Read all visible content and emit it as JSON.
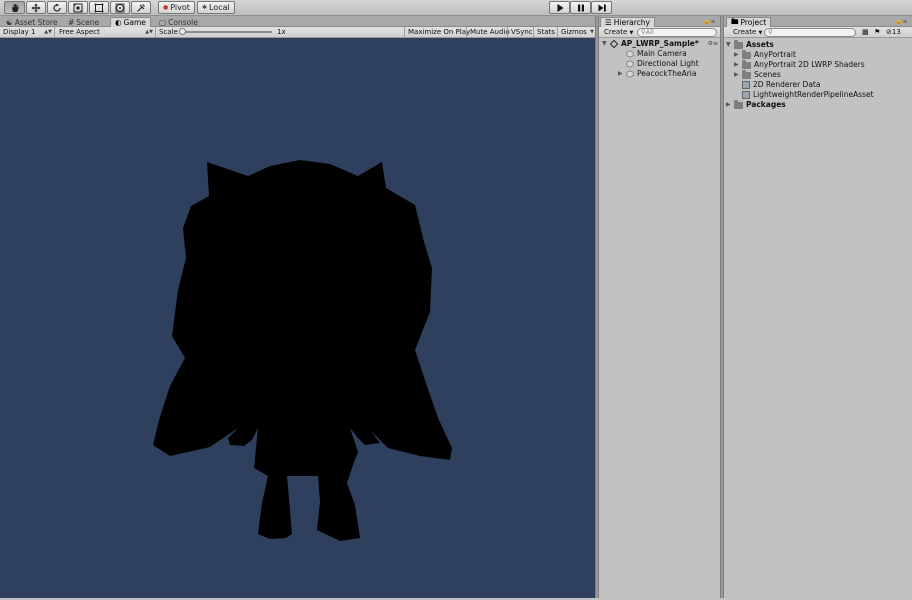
{
  "toolbar": {
    "tools": [
      "hand-tool",
      "move-tool",
      "rotate-tool",
      "scale-tool",
      "rect-tool",
      "transform-tool",
      "custom-tool"
    ],
    "pivot_label": "Pivot",
    "local_label": "Local",
    "play": "play",
    "pause": "pause",
    "step": "step"
  },
  "left_tabs": {
    "asset_store": "Asset Store",
    "scene": "Scene",
    "game": "Game",
    "console": "Console"
  },
  "game_bar": {
    "display": "Display 1",
    "aspect": "Free Aspect",
    "scale_label": "Scale",
    "scale_value": "1x",
    "maximize": "Maximize On Play",
    "mute": "Mute Audio",
    "vsync": "VSync",
    "stats": "Stats",
    "gizmos": "Gizmos"
  },
  "hierarchy": {
    "tab": "Hierarchy",
    "create": "Create",
    "search_placeholder": "All",
    "scene_name": "AP_LWRP_Sample*",
    "items": [
      "Main Camera",
      "Directional Light",
      "PeacockTheAria"
    ]
  },
  "project": {
    "tab": "Project",
    "create": "Create",
    "count": "13",
    "root": "Assets",
    "items": [
      "AnyPortrait",
      "AnyPortrait 2D LWRP Shaders",
      "Scenes",
      "2D Renderer Data",
      "LightweightRenderPipelineAsset"
    ],
    "packages": "Packages"
  },
  "colors": {
    "game_background": "#2f405f",
    "silhouette": "#000000"
  }
}
